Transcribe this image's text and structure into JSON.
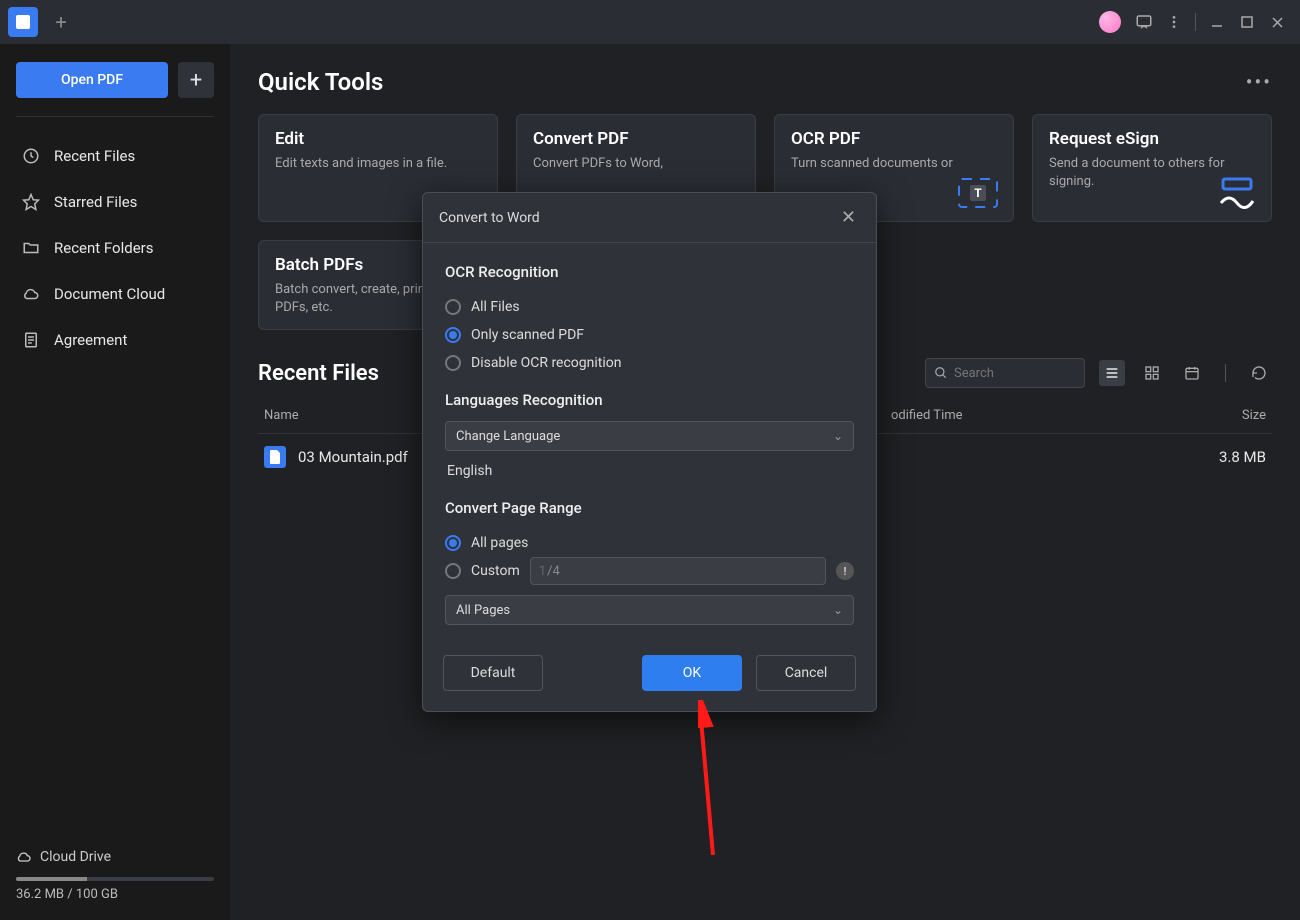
{
  "titlebar": {
    "add_tab_tooltip": "New Tab"
  },
  "sidebar": {
    "open_label": "Open PDF",
    "nav": [
      {
        "label": "Recent Files",
        "icon": "clock-icon"
      },
      {
        "label": "Starred Files",
        "icon": "star-icon"
      },
      {
        "label": "Recent Folders",
        "icon": "folder-icon"
      },
      {
        "label": "Document Cloud",
        "icon": "cloud-icon"
      },
      {
        "label": "Agreement",
        "icon": "doc-icon"
      }
    ],
    "cloud_label": "Cloud Drive",
    "storage_text": "36.2 MB / 100 GB"
  },
  "quick_tools": {
    "title": "Quick Tools",
    "cards": [
      {
        "title": "Edit",
        "desc": "Edit texts and images in a file."
      },
      {
        "title": "Convert PDF",
        "desc": "Convert PDFs to Word,"
      },
      {
        "title": "OCR PDF",
        "desc": "Turn scanned documents or"
      },
      {
        "title": "Request eSign",
        "desc": "Send a document to others for signing."
      }
    ],
    "batch": {
      "title": "Batch PDFs",
      "desc": "Batch convert, create, print, OCR PDFs, etc."
    }
  },
  "recent": {
    "title": "Recent Files",
    "search_placeholder": "Search",
    "cols": {
      "name": "Name",
      "mtime": "odified Time",
      "size": "Size"
    },
    "files": [
      {
        "name": "03 Mountain.pdf",
        "size": "3.8 MB"
      }
    ]
  },
  "dialog": {
    "title": "Convert to Word",
    "ocr_header": "OCR Recognition",
    "ocr_options": {
      "all": "All Files",
      "scanned": "Only scanned PDF",
      "disable": "Disable OCR recognition"
    },
    "ocr_selected": "scanned",
    "lang_header": "Languages Recognition",
    "lang_select": "Change Language",
    "lang_value": "English",
    "range_header": "Convert Page Range",
    "range_all": "All pages",
    "range_custom": "Custom",
    "range_selected": "all",
    "range_placeholder": "1",
    "range_total": "/4",
    "range_select": "All Pages",
    "buttons": {
      "default": "Default",
      "ok": "OK",
      "cancel": "Cancel"
    }
  }
}
